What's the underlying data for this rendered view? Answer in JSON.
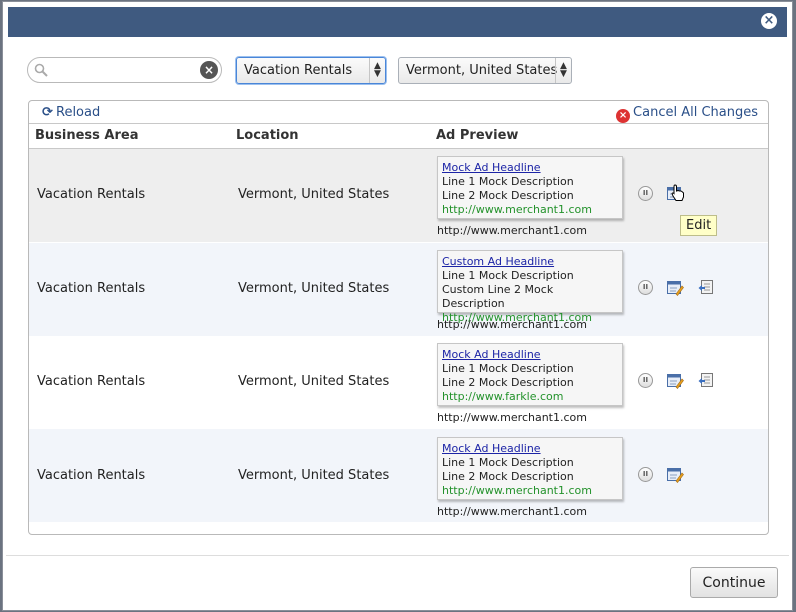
{
  "dialog": {
    "close_label": "×"
  },
  "filters": {
    "search_value": "",
    "search_placeholder": "",
    "business_area_selected": "Vacation Rentals",
    "location_selected": "Vermont, United States"
  },
  "toolbar": {
    "reload_label": "Reload",
    "cancel_all_label": "Cancel All Changes"
  },
  "table": {
    "headers": [
      "Business Area",
      "Location",
      "Ad Preview"
    ],
    "rows": [
      {
        "business_area": "Vacation Rentals",
        "location": "Vermont, United States",
        "ad": {
          "headline": "Mock Ad Headline",
          "line1": "Line 1 Mock Description",
          "line2": "Line 2 Mock Description",
          "url": "http://www.merchant1.com"
        },
        "display_url": "http://www.merchant1.com"
      },
      {
        "business_area": "Vacation Rentals",
        "location": "Vermont, United States",
        "ad": {
          "headline": "Custom Ad Headline",
          "line1": "Line 1 Mock Description",
          "line2": "Custom Line 2 Mock Description",
          "url": "http://www.merchant1.com"
        },
        "display_url": "http://www.merchant1.com"
      },
      {
        "business_area": "Vacation Rentals",
        "location": "Vermont, United States",
        "ad": {
          "headline": "Mock Ad Headline",
          "line1": "Line 1 Mock Description",
          "line2": "Line 2 Mock Description",
          "url": "http://www.farkle.com"
        },
        "display_url": "http://www.merchant1.com"
      },
      {
        "business_area": "Vacation Rentals",
        "location": "Vermont, United States",
        "ad": {
          "headline": "Mock Ad Headline",
          "line1": "Line 1 Mock Description",
          "line2": "Line 2 Mock Description",
          "url": "http://www.merchant1.com"
        },
        "display_url": "http://www.merchant1.com"
      }
    ]
  },
  "tooltip": {
    "text": "Edit"
  },
  "footer": {
    "continue_label": "Continue"
  },
  "colors": {
    "titlebar": "#3f5a80",
    "link": "#2a4f88",
    "ad_headline": "#1c24a6",
    "ad_url": "#23922b"
  }
}
